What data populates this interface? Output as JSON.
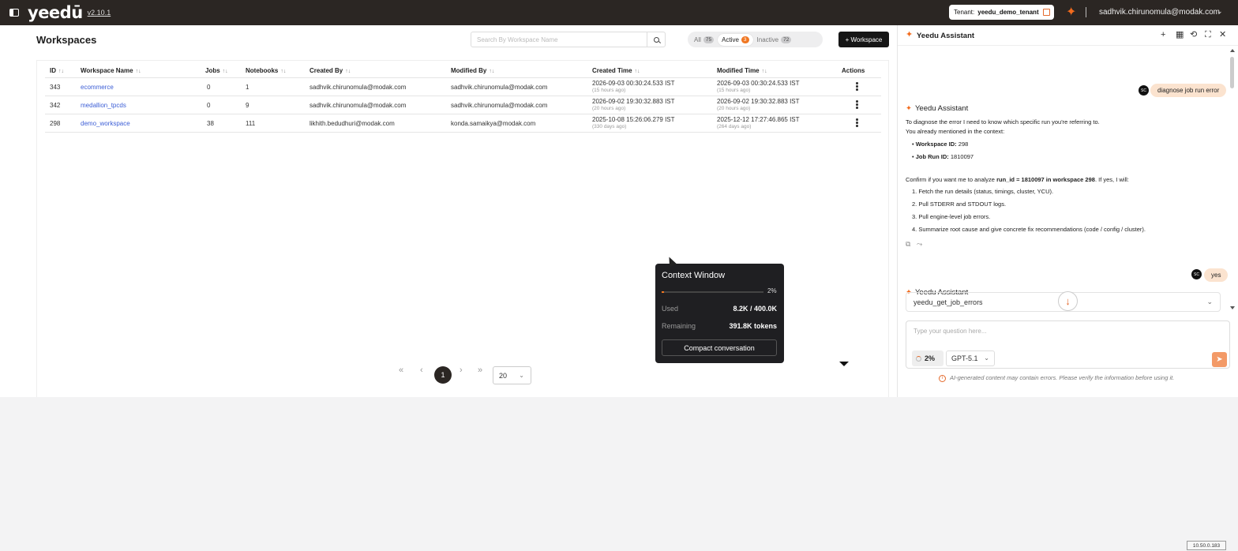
{
  "topbar": {
    "logo": "yeedū",
    "version": "v2.10.1",
    "tenant_label": "Tenant:",
    "tenant_name": "yeedu_demo_tenant",
    "user_email": "sadhvik.chirunomula@modak.com"
  },
  "workspaces": {
    "title": "Workspaces",
    "search_placeholder": "Search By Workspace Name",
    "filters": [
      {
        "label": "All",
        "count": "75"
      },
      {
        "label": "Active",
        "count": "3"
      },
      {
        "label": "Inactive",
        "count": "72"
      }
    ],
    "add_button": "+ Workspace",
    "columns": [
      "ID",
      "Workspace Name",
      "Jobs",
      "Notebooks",
      "Created By",
      "Modified By",
      "Created Time",
      "Modified Time",
      "Actions"
    ],
    "rows": [
      {
        "id": "343",
        "name": "ecommerce",
        "jobs": "0",
        "notebooks": "1",
        "created_by": "sadhvik.chirunomula@modak.com",
        "modified_by": "sadhvik.chirunomula@modak.com",
        "created_time": "2026-09-03 00:30:24.533 IST",
        "created_ago": "(15 hours ago)",
        "modified_time": "2026-09-03 00:30:24.533 IST",
        "modified_ago": "(15 hours ago)"
      },
      {
        "id": "342",
        "name": "medallion_tpcds",
        "jobs": "0",
        "notebooks": "9",
        "created_by": "sadhvik.chirunomula@modak.com",
        "modified_by": "sadhvik.chirunomula@modak.com",
        "created_time": "2026-09-02 19:30:32.883 IST",
        "created_ago": "(20 hours ago)",
        "modified_time": "2026-09-02 19:30:32.883 IST",
        "modified_ago": "(20 hours ago)"
      },
      {
        "id": "298",
        "name": "demo_workspace",
        "jobs": "38",
        "notebooks": "111",
        "created_by": "likhith.bedudhuri@modak.com",
        "modified_by": "konda.samaikya@modak.com",
        "created_time": "2025-10-08 15:26:06.279 IST",
        "created_ago": "(330 days ago)",
        "modified_time": "2025-12-12 17:27:46.865 IST",
        "modified_ago": "(264 days ago)"
      }
    ],
    "pagination": {
      "first": "«",
      "prev": "‹",
      "current": "1",
      "next": "›",
      "last": "»",
      "page_size": "20"
    }
  },
  "context_popover": {
    "title": "Context Window",
    "percent_label": "2%",
    "percent_value": 2,
    "used_label": "Used",
    "used_value": "8.2K / 400.0K",
    "remaining_label": "Remaining",
    "remaining_value": "391.8K tokens",
    "button": "Compact conversation"
  },
  "assistant": {
    "title": "Yeedu Assistant",
    "user_initials": "SC",
    "messages": {
      "user_1": "diagnose job run error",
      "bot_name": "Yeedu Assistant",
      "intro_1": "To diagnose the error I need to know which specific run you're referring to.",
      "intro_2": "You already mentioned in the context:",
      "ctx_ws_label": "Workspace ID:",
      "ctx_ws_value": "298",
      "ctx_run_label": "Job Run ID:",
      "ctx_run_value": "1810097",
      "confirm_pre": "Confirm if you want me to analyze ",
      "confirm_bold": "run_id = 1810097 in workspace 298",
      "confirm_post": ". If yes, I will:",
      "steps": [
        "1. Fetch the run details (status, timings, cluster, YCU).",
        "2. Pull STDERR and STDOUT logs.",
        "3. Pull engine-level job errors.",
        "4. Summarize root cause and give concrete fix recommendations (code / config / cluster)."
      ],
      "user_2": "yes",
      "tool_call": "yeedu_get_job_errors"
    },
    "composer_placeholder": "Type your question here...",
    "context_chip": "2%",
    "model": "GPT-5.1",
    "disclaimer": "AI-generated content may contain errors. Please verify the information before using it."
  },
  "footer": {
    "ip": "10.50.0.183"
  },
  "colors": {
    "accent": "#f07722",
    "topbar": "#2b2623",
    "link": "#3c5ed6"
  }
}
